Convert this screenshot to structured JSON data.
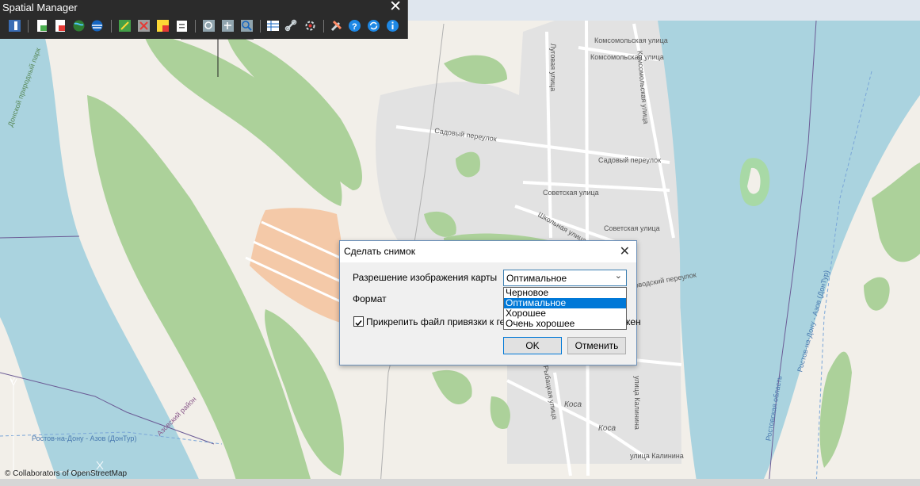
{
  "toolbar": {
    "title": "Spatial Manager",
    "icons": [
      "palette-icon",
      "import-icon",
      "export-icon",
      "globe-icon",
      "background-map-icon",
      "layer-edit-icon",
      "layer-delete-icon",
      "layer-color-icon",
      "clipboard-icon",
      "zoom-window-icon",
      "zoom-extents-icon",
      "zoom-in-icon",
      "table-icon",
      "link-icon",
      "settings-link-icon",
      "tools-icon",
      "help-icon",
      "refresh-icon",
      "info-icon"
    ]
  },
  "map": {
    "attribution": "© Collaborators of OpenStreetMap",
    "streets": [
      "Комсомольская улица",
      "Комсомольская улица",
      "Садовый переулок",
      "Садовый переулок",
      "Советская улица",
      "Советская улица",
      "Школьная улица",
      "Луговая улица",
      "Комсомольская улица",
      "улица Калинина",
      "улица Калинина",
      "Коса",
      "Коса",
      "Донской природный парк",
      "Азовский район",
      "Ростовская область",
      "Ростов-на-Дону - Азов (ДонТур)",
      "Ростов-на-Дону - Азов (ДонТур)",
      "Кисловодский переулок",
      "Рыбацкая улица"
    ]
  },
  "dialog": {
    "title": "Сделать снимок",
    "resolution_label": "Разрешение изображения карты",
    "resolution_value": "Оптимальное",
    "options": [
      "Черновое",
      "Оптимальное",
      "Хорошее",
      "Очень хорошее"
    ],
    "format_label": "Формат",
    "attach_label": "Прикрепить файл привязки к гео",
    "attach_label_tail": "кен",
    "ok": "OK",
    "cancel": "Отменить"
  }
}
